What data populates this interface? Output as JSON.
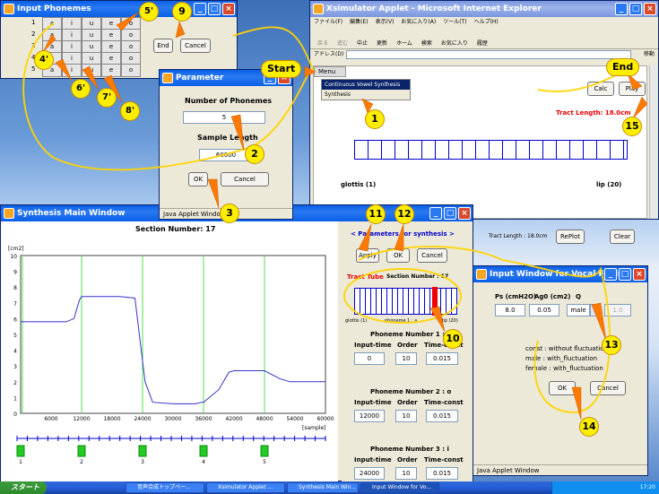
{
  "phoneme_window": {
    "title": "Input Phonemes",
    "rows": [
      {
        "num": "1",
        "cells": [
          "a",
          "i",
          "u",
          "e",
          "o"
        ]
      },
      {
        "num": "2",
        "cells": [
          "a",
          "i",
          "u",
          "e",
          "o"
        ]
      },
      {
        "num": "3",
        "cells": [
          "a",
          "i",
          "u",
          "e",
          "o"
        ]
      },
      {
        "num": "4",
        "cells": [
          "a",
          "i",
          "u",
          "e",
          "o"
        ]
      },
      {
        "num": "5",
        "cells": [
          "a",
          "i",
          "u",
          "e",
          "o"
        ]
      }
    ],
    "end_label": "End",
    "cancel_label": "Cancel"
  },
  "ie_window": {
    "title": "Xsimulator Applet - Microsoft Internet Explorer",
    "menus": [
      "ファイル(F)",
      "編集(E)",
      "表示(V)",
      "お気に入り(A)",
      "ツール(T)",
      "ヘルプ(H)"
    ],
    "toolbar": [
      "戻る",
      "進む",
      "中止",
      "更新",
      "ホーム",
      "検索",
      "お気に入り",
      "履歴"
    ],
    "address_label": "アドレス(D)",
    "go_label": "移動",
    "applet_menu": "Menu",
    "dropdown": [
      "Continuous Vowel Synthesis",
      "Synthesis"
    ],
    "calc_label": "Calc",
    "play_label": "Play",
    "tract_length": "Tract Length: 18.0cm",
    "glottis_label": "glottis (1)",
    "lip_label": "lip (20)",
    "bottom_tract": "Tract Length : 18.0cm",
    "replot_label": "RePlot",
    "clear_label": "Clear"
  },
  "param_window": {
    "title": "Parameter",
    "phonemes_label": "Number of Phonemes",
    "phonemes_value": "5",
    "sample_label": "Sample Length",
    "sample_value": "60000",
    "ok_label": "OK",
    "cancel_label": "Cancel",
    "status": "Java Applet Window"
  },
  "synth_window": {
    "title": "Synthesis Main Window",
    "section": "Section Number: 17",
    "params_title": "< Parameters for synthesis >",
    "apply_label": "Apply",
    "ok_label": "OK",
    "cancel_label": "Cancel",
    "tract_tube": "Tract Tube",
    "tube_section": "Section Number : 17",
    "tube_glottis": "glottis (1)",
    "tube_phoneme": "phoneme 1 : a",
    "tube_lip": "lip (20)",
    "phonemes": [
      {
        "title": "Phoneme Number 1 : a",
        "input_time": "0",
        "order": "10",
        "time_const": "0.015"
      },
      {
        "title": "Phoneme Number 2 : o",
        "input_time": "12000",
        "order": "10",
        "time_const": "0.015"
      },
      {
        "title": "Phoneme Number 3 : i",
        "input_time": "24000",
        "order": "10",
        "time_const": "0.015"
      }
    ],
    "col_input": "Input-time",
    "col_order": "Order",
    "col_const": "Time-const"
  },
  "vocal_window": {
    "title": "Input Window for Vocal Folds",
    "ps_label": "Ps (cmH2O)",
    "ag_label": "Ag0 (cm2)",
    "q_label": "Q",
    "ps_value": "8.0",
    "ag_value": "0.05",
    "q_value": "male",
    "q_extra": "1.0",
    "desc": [
      "const : without fluctuation",
      "male : with_fluctuation",
      "female : with_fluctuation"
    ],
    "ok_label": "OK",
    "cancel_label": "Cancel",
    "status": "Java Applet Window"
  },
  "chart_data": {
    "type": "line",
    "ylabel": "[cm2]",
    "xlabel": "[sample]",
    "ylim": [
      0,
      10
    ],
    "xlim": [
      0,
      60000
    ],
    "yticks": [
      "0",
      "1",
      "2",
      "3",
      "4",
      "5",
      "6",
      "7",
      "8",
      "9",
      "10"
    ],
    "xticks": [
      "6000",
      "12000",
      "18000",
      "24000",
      "30000",
      "36000",
      "42000",
      "48000",
      "54000",
      "60000"
    ],
    "markers": [
      1,
      2,
      3,
      4,
      5
    ],
    "markers_x": [
      0,
      12000,
      24000,
      36000,
      48000
    ],
    "series": [
      {
        "points": [
          [
            0,
            5.8
          ],
          [
            9000,
            5.8
          ],
          [
            10500,
            6.0
          ],
          [
            11600,
            7.2
          ],
          [
            12000,
            7.4
          ],
          [
            16500,
            7.4
          ],
          [
            19500,
            7.4
          ],
          [
            22500,
            7.3
          ],
          [
            24500,
            2.0
          ],
          [
            26000,
            0.7
          ],
          [
            30000,
            0.6
          ],
          [
            34500,
            0.6
          ],
          [
            35500,
            0.7
          ],
          [
            36000,
            0.7
          ],
          [
            39000,
            1.5
          ],
          [
            41000,
            2.6
          ],
          [
            42000,
            2.7
          ],
          [
            48000,
            2.7
          ],
          [
            51000,
            2.2
          ],
          [
            53000,
            2.0
          ],
          [
            60000,
            2.0
          ]
        ]
      }
    ]
  },
  "annotations": {
    "start": "Start",
    "end": "End",
    "n1": "1",
    "n2": "2",
    "n3": "3",
    "n4p": "4'",
    "n5p": "5'",
    "n6p": "6'",
    "n7p": "7'",
    "n8p": "8'",
    "n9": "9",
    "n10": "10",
    "n11": "11",
    "n12": "12",
    "n13": "13",
    "n14": "14",
    "n15": "15"
  },
  "taskbar": {
    "start": "スタート",
    "tasks": [
      "音声合成トップペー...",
      "Xsimulator Applet ...",
      "Synthesis Main Win...",
      "Input Window for Vo..."
    ],
    "clock": "17:20"
  }
}
